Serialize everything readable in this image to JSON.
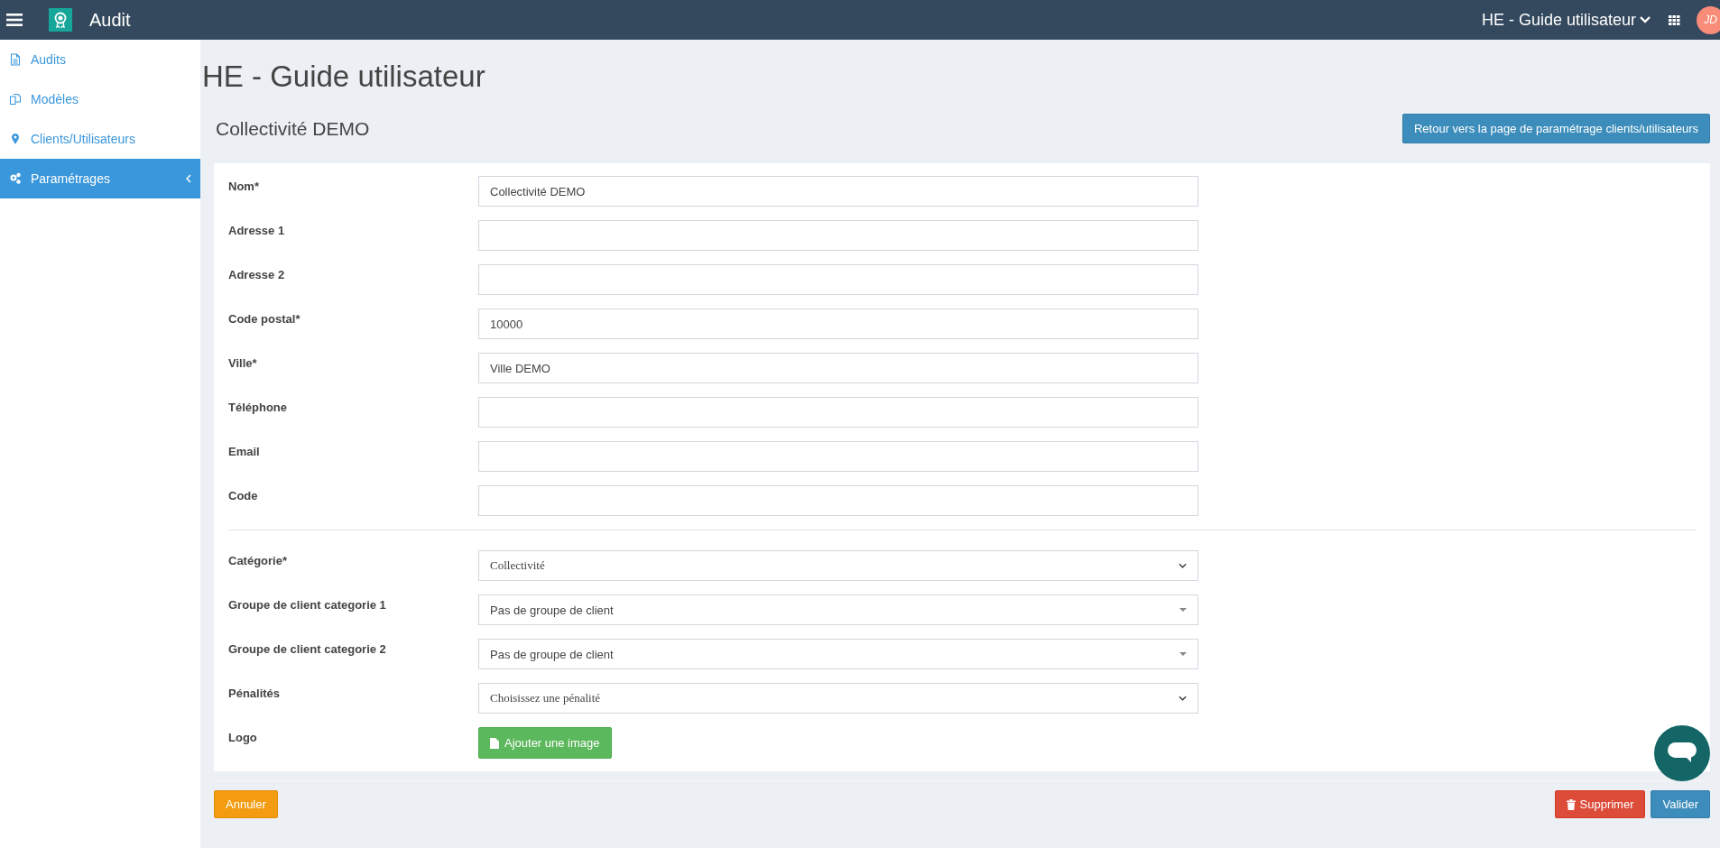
{
  "topbar": {
    "app_name": "Audit",
    "workspace": "HE - Guide utilisateur",
    "avatar": "JD"
  },
  "sidebar": {
    "items": [
      {
        "label": "Audits",
        "selected": false,
        "has_submenu": false
      },
      {
        "label": "Modèles",
        "selected": false,
        "has_submenu": false
      },
      {
        "label": "Clients/Utilisateurs",
        "selected": false,
        "has_submenu": false
      },
      {
        "label": "Paramétrages",
        "selected": true,
        "has_submenu": true
      }
    ]
  },
  "page_title": "HE - Guide utilisateur",
  "section_title": "Collectivité DEMO",
  "back_button": "Retour vers la page de paramétrage clients/utilisateurs",
  "form": {
    "fields": [
      {
        "label": "Nom*",
        "kind": "text",
        "value": "Collectivité DEMO"
      },
      {
        "label": "Adresse 1",
        "kind": "text"
      },
      {
        "label": "Adresse 2",
        "kind": "text"
      },
      {
        "label": "Code postal*",
        "kind": "text",
        "value": "10000"
      },
      {
        "label": "Ville*",
        "kind": "text",
        "value": "Ville DEMO"
      },
      {
        "label": "Téléphone",
        "kind": "text"
      },
      {
        "label": "Email",
        "kind": "text"
      },
      {
        "label": "Code",
        "kind": "text"
      },
      {
        "kind": "divider"
      },
      {
        "label": "Catégorie*",
        "kind": "select",
        "value": "Collectivité"
      },
      {
        "label": "Groupe de client categorie 1",
        "kind": "combo",
        "value": "Pas de groupe de client"
      },
      {
        "label": "Groupe de client categorie 2",
        "kind": "combo",
        "value": "Pas de groupe de client"
      },
      {
        "label": "Pénalités",
        "kind": "select",
        "value": "Choisissez une pénalité"
      },
      {
        "label": "Logo",
        "kind": "upload",
        "value": "Ajouter une image"
      }
    ]
  },
  "footer_buttons": [
    {
      "label": "Annuler",
      "kind": "cancel"
    },
    {
      "label": "Supprimer",
      "kind": "delete"
    },
    {
      "label": "Valider",
      "kind": "submit"
    }
  ]
}
